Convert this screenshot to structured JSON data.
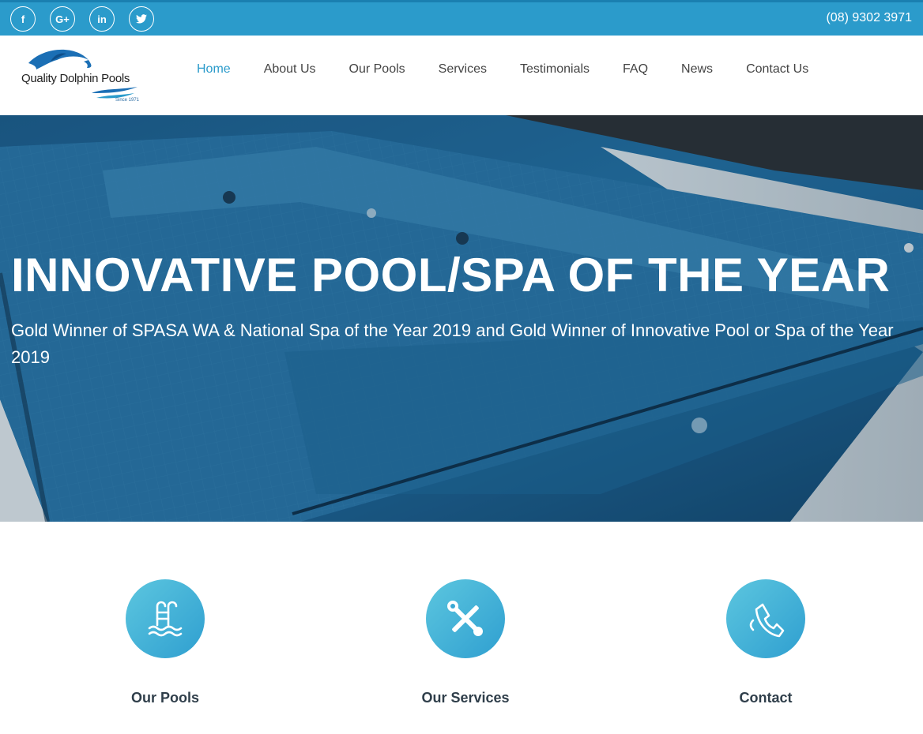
{
  "topbar": {
    "social": [
      {
        "icon": "facebook-icon",
        "glyph": "f"
      },
      {
        "icon": "google-plus-icon",
        "glyph": "G+"
      },
      {
        "icon": "linkedin-icon",
        "glyph": "in"
      },
      {
        "icon": "twitter-icon",
        "glyph": ""
      }
    ],
    "phone": "(08) 9302 3971"
  },
  "header": {
    "logo_text": "Quality Dolphin Pools",
    "logo_since": "Since 1971",
    "nav": [
      {
        "label": "Home",
        "active": true
      },
      {
        "label": "About Us"
      },
      {
        "label": "Our Pools"
      },
      {
        "label": "Services"
      },
      {
        "label": "Testimonials"
      },
      {
        "label": "FAQ"
      },
      {
        "label": "News"
      },
      {
        "label": "Contact Us"
      }
    ]
  },
  "hero": {
    "title": "INNOVATIVE POOL/SPA OF THE YEAR",
    "subtitle": "Gold Winner of SPASA WA & National Spa of the Year 2019 and Gold Winner of Innovative Pool or Spa of the Year 2019"
  },
  "features": [
    {
      "label": "Our Pools",
      "icon": "pool-ladder-icon"
    },
    {
      "label": "Our Services",
      "icon": "tools-icon"
    },
    {
      "label": "Contact",
      "icon": "phone-icon"
    }
  ],
  "colors": {
    "brand": "#2b9bcb",
    "heading": "#2f3e4a"
  }
}
